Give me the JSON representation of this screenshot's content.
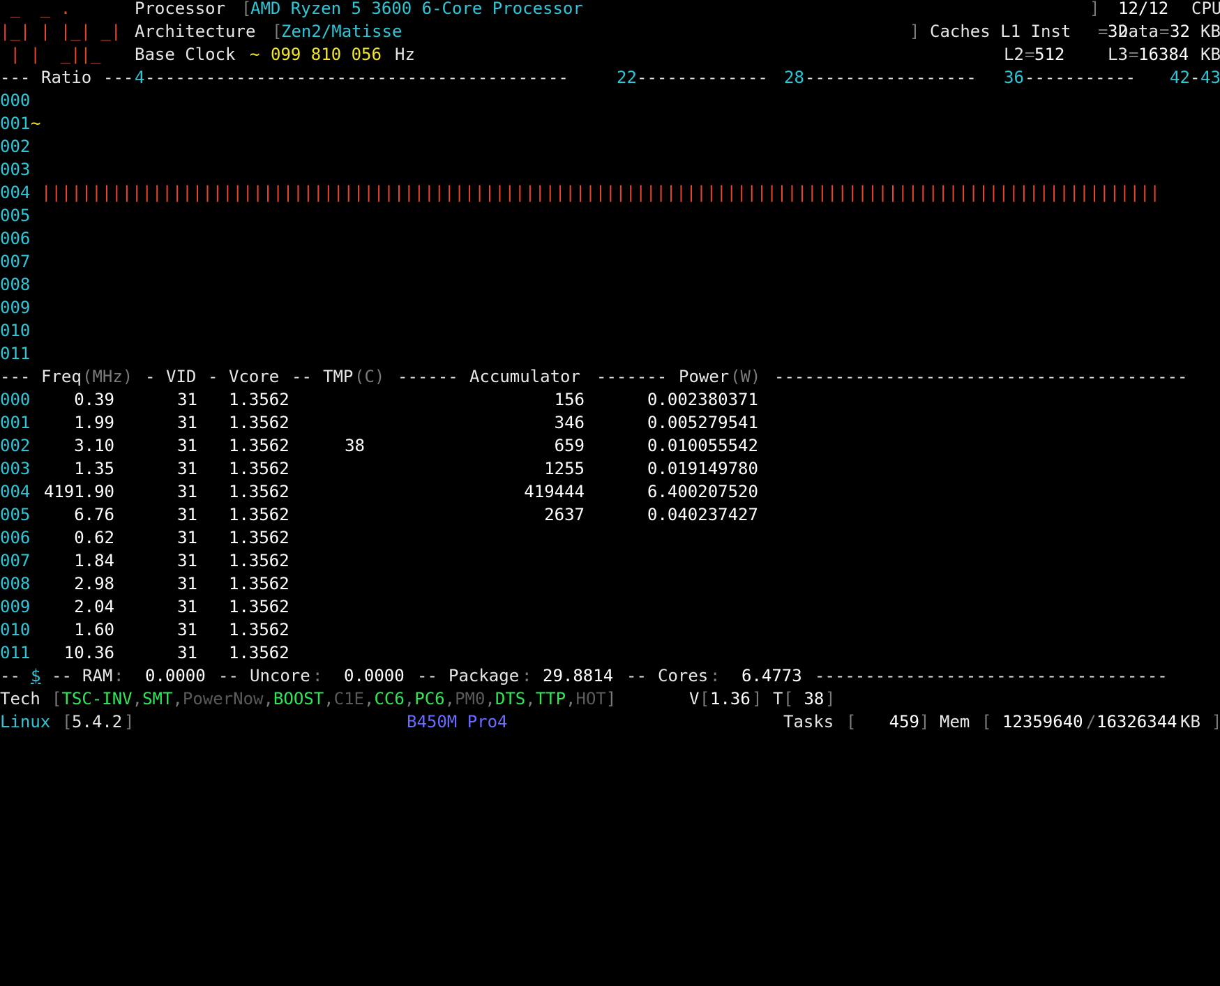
{
  "header": {
    "logo_line1": " _  _ .",
    "logo_line2": "|_| | |_| _|",
    "logo_line3": " | |  _||_",
    "processor_label": "Processor",
    "processor_name": "AMD Ryzen 5 3600 6-Core Processor",
    "cpu_count": "12/12",
    "cpu_label": "CPU",
    "architecture_label": "Architecture",
    "architecture_name": "Zen2/Matisse",
    "caches_label": "Caches L1 Inst",
    "l1_inst": "32",
    "data_label": "Data",
    "l1_data": "32",
    "kb_label": "KB",
    "base_clock_label": "Base Clock",
    "base_clock_tilde": "~",
    "base_clock_value": "099 810 056",
    "hz_label": "Hz",
    "l2_label": "L2",
    "l2_value": "512",
    "l3_label": "L3",
    "l3_value": "16384"
  },
  "ratio_header": {
    "label": "Ratio",
    "ticks": [
      "4",
      "22",
      "28",
      "36",
      "42",
      "43"
    ]
  },
  "ratio_rows": [
    {
      "cpu": "000",
      "marker": "",
      "bar_fraction": 0
    },
    {
      "cpu": "001",
      "marker": "~",
      "bar_fraction": 0
    },
    {
      "cpu": "002",
      "marker": "",
      "bar_fraction": 0
    },
    {
      "cpu": "003",
      "marker": "",
      "bar_fraction": 0
    },
    {
      "cpu": "004",
      "marker": "",
      "bar_fraction": 1
    },
    {
      "cpu": "005",
      "marker": "",
      "bar_fraction": 0
    },
    {
      "cpu": "006",
      "marker": "",
      "bar_fraction": 0
    },
    {
      "cpu": "007",
      "marker": "",
      "bar_fraction": 0
    },
    {
      "cpu": "008",
      "marker": "",
      "bar_fraction": 0
    },
    {
      "cpu": "009",
      "marker": "",
      "bar_fraction": 0
    },
    {
      "cpu": "010",
      "marker": "",
      "bar_fraction": 0
    },
    {
      "cpu": "011",
      "marker": "",
      "bar_fraction": 0
    }
  ],
  "table_header": {
    "freq": "Freq",
    "freq_unit": "(MHz)",
    "vid": "VID",
    "vcore": "Vcore",
    "tmp": "TMP",
    "tmp_unit": "(C)",
    "accumulator": "Accumulator",
    "power": "Power",
    "power_unit": "(W)"
  },
  "table_rows": [
    {
      "cpu": "000",
      "freq": "0.39",
      "vid": "31",
      "vcore": "1.3562",
      "tmp": "",
      "acc": "156",
      "power": "0.002380371"
    },
    {
      "cpu": "001",
      "freq": "1.99",
      "vid": "31",
      "vcore": "1.3562",
      "tmp": "",
      "acc": "346",
      "power": "0.005279541"
    },
    {
      "cpu": "002",
      "freq": "3.10",
      "vid": "31",
      "vcore": "1.3562",
      "tmp": "38",
      "acc": "659",
      "power": "0.010055542"
    },
    {
      "cpu": "003",
      "freq": "1.35",
      "vid": "31",
      "vcore": "1.3562",
      "tmp": "",
      "acc": "1255",
      "power": "0.019149780"
    },
    {
      "cpu": "004",
      "freq": "4191.90",
      "vid": "31",
      "vcore": "1.3562",
      "tmp": "",
      "acc": "419444",
      "power": "6.400207520"
    },
    {
      "cpu": "005",
      "freq": "6.76",
      "vid": "31",
      "vcore": "1.3562",
      "tmp": "",
      "acc": "2637",
      "power": "0.040237427"
    },
    {
      "cpu": "006",
      "freq": "0.62",
      "vid": "31",
      "vcore": "1.3562",
      "tmp": "",
      "acc": "",
      "power": ""
    },
    {
      "cpu": "007",
      "freq": "1.84",
      "vid": "31",
      "vcore": "1.3562",
      "tmp": "",
      "acc": "",
      "power": ""
    },
    {
      "cpu": "008",
      "freq": "2.98",
      "vid": "31",
      "vcore": "1.3562",
      "tmp": "",
      "acc": "",
      "power": ""
    },
    {
      "cpu": "009",
      "freq": "2.04",
      "vid": "31",
      "vcore": "1.3562",
      "tmp": "",
      "acc": "",
      "power": ""
    },
    {
      "cpu": "010",
      "freq": "1.60",
      "vid": "31",
      "vcore": "1.3562",
      "tmp": "",
      "acc": "",
      "power": ""
    },
    {
      "cpu": "011",
      "freq": "10.36",
      "vid": "31",
      "vcore": "1.3562",
      "tmp": "",
      "acc": "",
      "power": ""
    }
  ],
  "power_summary": {
    "dollar": "$",
    "ram_label": "RAM",
    "ram_value": "0.0000",
    "uncore_label": "Uncore",
    "uncore_value": "0.0000",
    "package_label": "Package",
    "package_value": "29.8814",
    "cores_label": "Cores",
    "cores_value": "6.4773"
  },
  "tech": {
    "label": "Tech",
    "flags": [
      {
        "name": "TSC-INV",
        "state": "on"
      },
      {
        "name": "SMT",
        "state": "on"
      },
      {
        "name": "PowerNow",
        "state": "off"
      },
      {
        "name": "BOOST",
        "state": "on"
      },
      {
        "name": "C1E",
        "state": "off"
      },
      {
        "name": "CC6",
        "state": "on"
      },
      {
        "name": "PC6",
        "state": "on"
      },
      {
        "name": "PM0",
        "state": "off"
      },
      {
        "name": "DTS",
        "state": "on"
      },
      {
        "name": "TTP",
        "state": "on"
      },
      {
        "name": "HOT",
        "state": "off"
      }
    ],
    "v_label": "V",
    "v_value": "1.36",
    "t_label": "T",
    "t_value": " 38"
  },
  "status": {
    "os": "Linux",
    "kernel": "5.4.2",
    "board": "B450M Pro4",
    "tasks_label": "Tasks",
    "tasks_value": "459",
    "mem_label": "Mem",
    "mem_used": "12359640",
    "mem_total": "16326344",
    "mem_unit": "KB"
  },
  "colors": {
    "background": "#000000",
    "cyan": "#2ec6d8",
    "yellow": "#f2e628",
    "red": "#e8452f",
    "green": "#2ee857",
    "blue": "#6b6bff",
    "gray": "#7a7a7a"
  }
}
